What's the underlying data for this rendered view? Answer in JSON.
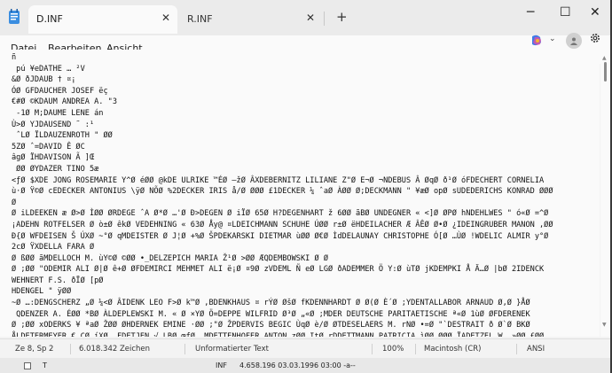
{
  "tabs": [
    {
      "label": "D.INF",
      "close": "✕"
    },
    {
      "label": "R.INF",
      "close": "✕"
    }
  ],
  "new_tab": "+",
  "window_controls": {
    "minimize": "─",
    "maximize": "☐",
    "close": "✕"
  },
  "menu": {
    "file": "Datei",
    "edit": "Bearbeiten",
    "view": "Ansicht"
  },
  "copilot_chevron": "⌄",
  "editor_text": "ñ\n pú ¥eDATHE … ²V\n&Ø ðJDAUB † ¤¡\nÓØ GFDAUCHER JOSEF ëç\n€#Ø ©KDAUM ANDREA A. \"3\n -1Ø M;DAUME LENE án\nÙ>Ø YJDAUSEND ˜ :¹\n ˆLØ ÏLDAUZENROTH \" ØØ\n5ZØ ˆ=DAVID Ê ØC\nâgØ ÏHDAVISON Ã ]Œ\n ØØ ØYDAZER TINO 5æ\n<ƒØ $XDE JONG ROSEMARIE Y^Ø éØØ @kDE ULRIKE ™ÉØ –žØ ÂXDEBERNITZ LILIANE Z\"Ø E¬Ø ¬NDEBUS Â ØqØ ð¹Ø óFDECHERT CORNELIA\nù·Ø Ÿ©Ø cEDECKER ANTONIUS \\ÿØ NÕØ %2DECKER IRIS å/Ø ØØØ £1DECKER ¼ ˆaØ ÀØØ Ø;DECKMANN \" ¥æØ opØ sUDEDERICHS KONRAD ØØØ\nØ\nØ iLDEEKEN æ Ø>Ø ÌØØ ØRDEGE ˆA Ø*Ø …'Ø Ð>DEGEN Ø iÏØ 65Ø H?DEGENHART ž 6ØØ ãBØ UNDEGNER « <]Ø ØPØ hNDEHLWES \" ó«Ø =^Ø\n¡ADEHN ROTFELSER Ø ò±Ø êkØ VEDEHNING « 63Ø Åy@ ¤LDEICHMANN SCHUHE ÚØØ r±Ø ëHDEILACHER Æ ÂÊØ Ø•Ø ¿IDEINGRUBER MANON ,ØØ\nÐ{Ø WFDEISEN Š ÚXØ ~°Ø qMDEISTER Ø J¦Ø +%Ø ŠPDEKARSKI DIETMAR ùØØ Ø€Ø ÌdDELAUNAY CHRISTOPHE Ó[Ø …ÙØ !WDELIC ALMIR y°Ø\n2cØ ŸXDELLA FARA Ø\nØ ßØØ ãMDELLOCH M. ùY©Ø ©ØØ •_DELZEPICH MARIA Ž¹Ø >ØØ ÆQDEMBOWSKI Ø Ø\nØ ;ØØ \"ODEMIR ALI Ø|Ø ê+Ø ØFDEMIRCI MEHMET ALI ë¡Ø ¤9Ø zVDEML Ñ eØ LGØ ðADEMMER Ö Y:Ø ùTØ jKDEMPKI Å Ä…Ø |bØ 2IDENCK\nWEHNERT F.S. ðÏØ [pØ\nHDENGEL \" ÿØØ\n~Ø …:DENGSCHERZ „Ø ¼<Ø ÂIDENK LEO F>Ø k™Ø ‚BDENKHAUS ¤ rÝØ ØšØ fKDENNHARDT Ø Ø(Ø È´Ø ;YDENTALLABOR ARNAUD Ø,Ø }ÅØ\n QDENZER A. ÉØØ *BØ ÀLDEPLEWSKI M. « Ø ×YØ Ö=DEPPE WILFRID Ø³Ø „«Ø ;MDER DEUTSCHE PARITAETISCHE ª«Ø 1ùØ ØFDERENEK\nØ ;ØØ xODERKS ¥ ªaØ ŽØØ ØHDERNEK EMINE ·ØØ ;\"Ø ŽPDERVIS BEGIC ÙqØ è/Ø ØTDESELAERS M. rNØ •=Ø \"`DESTRAIT ð Ø`Ø BKØ\nÅLDETERMEYER € CØ íXØ …FDETJEN √ LBØ œfØ .MDETTENHOFER ANTON zØØ ItØ rDDETTMANN PATRICIA ìØØ ØØØ ÏADETZEL W. »ØØ £ØØ",
  "status": {
    "position": "Ze 8, Sp 2",
    "chars": "6.018.342 Zeichen",
    "format": "Unformatierter Text",
    "zoom": "100%",
    "line_ending": "Macintosh (CR)",
    "encoding": "ANSI"
  },
  "taskrow": {
    "letter": "T",
    "type": "INF",
    "details": "4.658.196 03.03.1996 03:00 -a--"
  }
}
